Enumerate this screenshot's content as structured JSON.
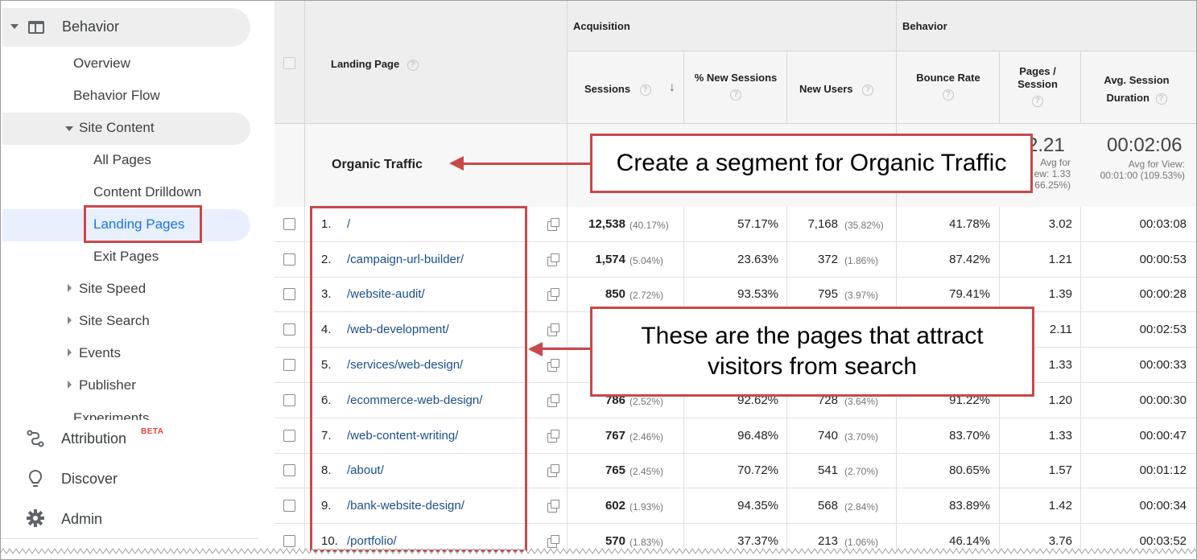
{
  "sidebar": {
    "behavior_label": "Behavior",
    "items": [
      "Overview",
      "Behavior Flow",
      "Site Content",
      "All Pages",
      "Content Drilldown",
      "Landing Pages",
      "Exit Pages",
      "Site Speed",
      "Site Search",
      "Events",
      "Publisher",
      "Experiments"
    ],
    "attribution_label": "Attribution",
    "beta_label": "BETA",
    "discover_label": "Discover",
    "admin_label": "Admin"
  },
  "table": {
    "landing_page_header": "Landing Page",
    "acquisition_header": "Acquisition",
    "behavior_header": "Behavior",
    "columns": {
      "sessions": "Sessions",
      "new_sessions": "% New Sessions",
      "new_users": "New Users",
      "bounce_rate": "Bounce Rate",
      "pages_session": "Pages / Session",
      "avg_duration": "Avg. Session Duration"
    },
    "help_glyph": "?",
    "sort_glyph": "↓",
    "segment_label": "Organic Traffic",
    "totals": {
      "pages_session_value": "2.21",
      "pages_session_sub1": "Avg for",
      "pages_session_sub2": "ew: 1.33",
      "pages_session_sub3": "66.25%)",
      "avg_duration_value": "00:02:06",
      "avg_duration_sub1": "Avg for View:",
      "avg_duration_sub2": "00:01:00 (109.53%)"
    },
    "rows": [
      {
        "idx": "1.",
        "page": "/",
        "sessions": "12,538",
        "sessions_pct": "(40.17%)",
        "new_sessions": "57.17%",
        "new_users": "7,168",
        "new_users_pct": "(35.82%)",
        "bounce": "41.78%",
        "pages": "3.02",
        "duration": "00:03:08"
      },
      {
        "idx": "2.",
        "page": "/campaign-url-builder/",
        "sessions": "1,574",
        "sessions_pct": "(5.04%)",
        "new_sessions": "23.63%",
        "new_users": "372",
        "new_users_pct": "(1.86%)",
        "bounce": "87.42%",
        "pages": "1.21",
        "duration": "00:00:53"
      },
      {
        "idx": "3.",
        "page": "/website-audit/",
        "sessions": "850",
        "sessions_pct": "(2.72%)",
        "new_sessions": "93.53%",
        "new_users": "795",
        "new_users_pct": "(3.97%)",
        "bounce": "79.41%",
        "pages": "1.39",
        "duration": "00:00:28"
      },
      {
        "idx": "4.",
        "page": "/web-development/",
        "sessions": "",
        "sessions_pct": "",
        "new_sessions": "",
        "new_users": "",
        "new_users_pct": "",
        "bounce": "",
        "pages": "2.11",
        "duration": "00:02:53"
      },
      {
        "idx": "5.",
        "page": "/services/web-design/",
        "sessions": "",
        "sessions_pct": "",
        "new_sessions": "",
        "new_users": "",
        "new_users_pct": "",
        "bounce": "",
        "pages": "1.33",
        "duration": "00:00:33"
      },
      {
        "idx": "6.",
        "page": "/ecommerce-web-design/",
        "sessions": "786",
        "sessions_pct": "(2.52%)",
        "new_sessions": "92.62%",
        "new_users": "728",
        "new_users_pct": "(3.64%)",
        "bounce": "91.22%",
        "pages": "1.20",
        "duration": "00:00:30"
      },
      {
        "idx": "7.",
        "page": "/web-content-writing/",
        "sessions": "767",
        "sessions_pct": "(2.46%)",
        "new_sessions": "96.48%",
        "new_users": "740",
        "new_users_pct": "(3.70%)",
        "bounce": "83.70%",
        "pages": "1.33",
        "duration": "00:00:47"
      },
      {
        "idx": "8.",
        "page": "/about/",
        "sessions": "765",
        "sessions_pct": "(2.45%)",
        "new_sessions": "70.72%",
        "new_users": "541",
        "new_users_pct": "(2.70%)",
        "bounce": "80.65%",
        "pages": "1.57",
        "duration": "00:01:12"
      },
      {
        "idx": "9.",
        "page": "/bank-website-design/",
        "sessions": "602",
        "sessions_pct": "(1.93%)",
        "new_sessions": "94.35%",
        "new_users": "568",
        "new_users_pct": "(2.84%)",
        "bounce": "83.89%",
        "pages": "1.42",
        "duration": "00:00:34"
      },
      {
        "idx": "10.",
        "page": "/portfolio/",
        "sessions": "570",
        "sessions_pct": "(1.83%)",
        "new_sessions": "37.37%",
        "new_users": "213",
        "new_users_pct": "(1.06%)",
        "bounce": "46.14%",
        "pages": "3.76",
        "duration": "00:03:52"
      }
    ]
  },
  "callouts": {
    "segment": "Create a segment for Organic Traffic",
    "pages_line1": "These are the pages that attract",
    "pages_line2": "visitors from search"
  },
  "colors": {
    "annotation_red": "#c9484a",
    "link_blue": "#1a4f8a",
    "active_blue": "#1a73e8"
  },
  "icons": [
    "behavior-icon",
    "attribution-icon",
    "discover-icon",
    "admin-gear-icon",
    "open-external-icon",
    "help-icon",
    "sort-descending-icon"
  ]
}
